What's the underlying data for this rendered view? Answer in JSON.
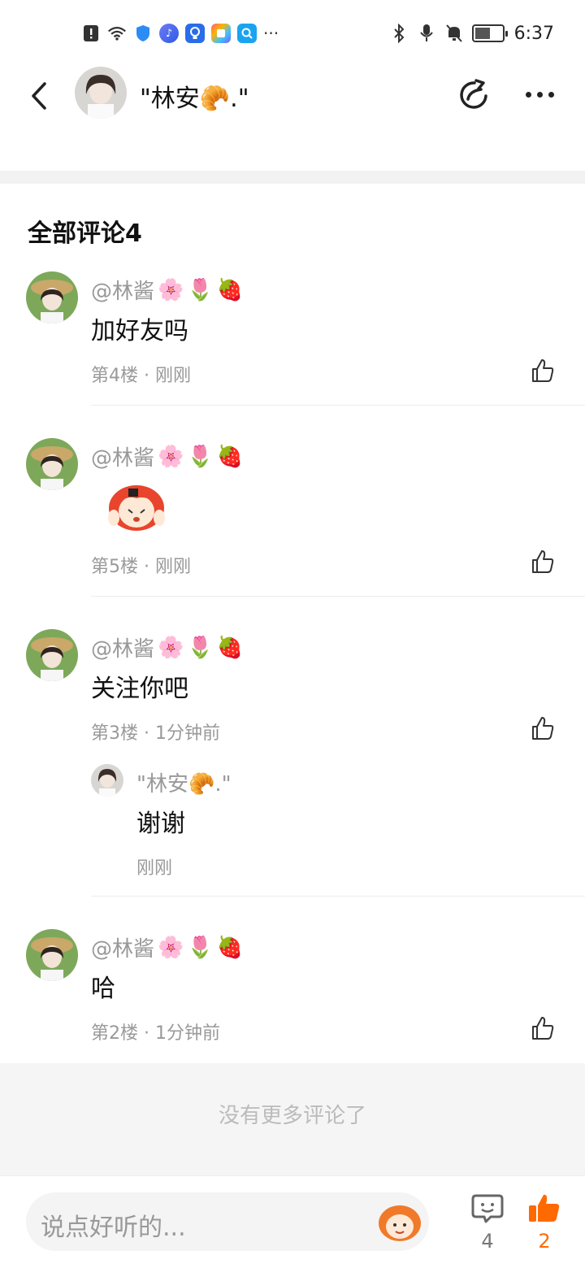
{
  "status_bar": {
    "time": "6:37",
    "left_icons": [
      "alert-icon",
      "wifi-icon",
      "shield-app-icon",
      "music-app-icon",
      "bulb-app-icon",
      "puzzle-app-icon",
      "search-app-icon",
      "more-notifications-icon"
    ],
    "right_icons": [
      "bluetooth-icon",
      "mic-icon",
      "mute-bell-icon",
      "battery-charging-icon"
    ],
    "overflow": "···"
  },
  "header": {
    "title": "\"林安🥐.\"",
    "back_icon": "chevron-left-icon",
    "share_icon": "share-icon",
    "more_icon": "more-icon"
  },
  "section": {
    "title": "全部评论4"
  },
  "comments": [
    {
      "name": "@林酱",
      "badges": [
        "🌸",
        "🌷",
        "🍓"
      ],
      "text": "加好友吗",
      "meta": "第4楼 · 刚刚"
    },
    {
      "name": "@林酱",
      "badges": [
        "🌸",
        "🌷",
        "🍓"
      ],
      "text": "",
      "sticker": "anime-sticker",
      "meta": "第5楼 · 刚刚"
    },
    {
      "name": "@林酱",
      "badges": [
        "🌸",
        "🌷",
        "🍓"
      ],
      "text": "关注你吧",
      "meta": "第3楼 · 1分钟前",
      "reply": {
        "name": "\"林安🥐.\"",
        "text": "谢谢",
        "meta": "刚刚"
      }
    },
    {
      "name": "@林酱",
      "badges": [
        "🌸",
        "🌷",
        "🍓"
      ],
      "text": "哈",
      "meta": "第2楼 · 1分钟前"
    }
  ],
  "footer_note": "没有更多评论了",
  "bottom_bar": {
    "input_placeholder": "说点好听的...",
    "comment_count": "4",
    "like_count": "2",
    "accent_color": "#ff6a00"
  }
}
